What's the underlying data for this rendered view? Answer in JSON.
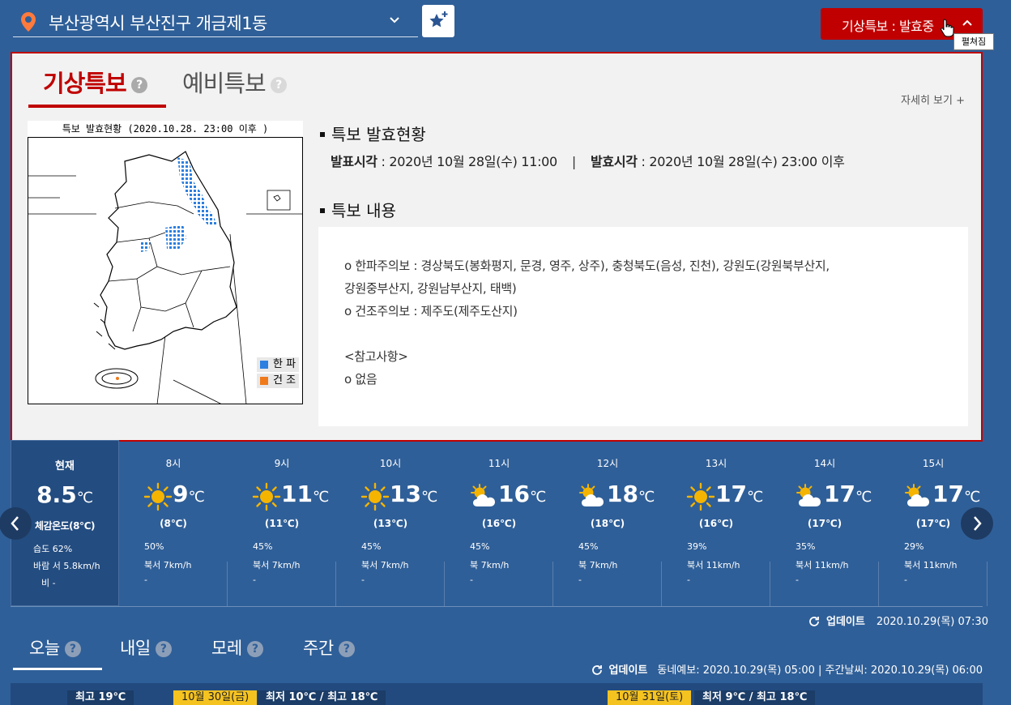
{
  "location": {
    "name": "부산광역시 부산진구 개금제1동"
  },
  "alert_button": {
    "label": "기상특보 : 발효중",
    "tooltip": "펼쳐짐"
  },
  "panel": {
    "tabs": [
      {
        "label": "기상특보",
        "help": "?"
      },
      {
        "label": "예비특보",
        "help": "?"
      }
    ],
    "more_link": "자세히 보기 +",
    "map": {
      "title": "특보 발효현황 (2020.10.28. 23:00 이후 )",
      "legend": [
        {
          "label": "한 파",
          "color": "#2b7fe0"
        },
        {
          "label": "건 조",
          "color": "#f07a1a"
        }
      ]
    },
    "status": {
      "heading": "특보 발효현황",
      "announce_label": "발표시각",
      "announce_value": " : 2020년 10월 28일(수) 11:00",
      "separator": "|",
      "effective_label": "발효시각",
      "effective_value": " : 2020년 10월 28일(수) 23:00 이후"
    },
    "content": {
      "heading": "특보 내용",
      "lines": [
        "o 한파주의보 : 경상북도(봉화평지, 문경, 영주, 상주), 충청북도(음성, 진천), 강원도(강원북부산지,",
        "강원중부산지, 강원남부산지, 태백)",
        "o 건조주의보 : 제주도(제주도산지)",
        "",
        "<참고사항>",
        "o 없음"
      ]
    }
  },
  "current": {
    "label": "현재",
    "temp": "8.5",
    "unit": "℃",
    "feels": "체감온도(8℃)",
    "humidity": "습도 62%",
    "wind": "바람 서 5.8km/h",
    "rain": "비 -"
  },
  "hourly": [
    {
      "hour": "8시",
      "icon": "sun-icon",
      "temp": "9",
      "feels": "(8℃)",
      "humidity": "50%",
      "wind": "북서 7km/h",
      "rain": "-"
    },
    {
      "hour": "9시",
      "icon": "sun-icon",
      "temp": "11",
      "feels": "(11℃)",
      "humidity": "45%",
      "wind": "북서 7km/h",
      "rain": "-"
    },
    {
      "hour": "10시",
      "icon": "sun-icon",
      "temp": "13",
      "feels": "(13℃)",
      "humidity": "45%",
      "wind": "북서 7km/h",
      "rain": "-"
    },
    {
      "hour": "11시",
      "icon": "partly-cloudy-icon",
      "temp": "16",
      "feels": "(16℃)",
      "humidity": "45%",
      "wind": "북 7km/h",
      "rain": "-"
    },
    {
      "hour": "12시",
      "icon": "partly-cloudy-icon",
      "temp": "18",
      "feels": "(18℃)",
      "humidity": "45%",
      "wind": "북 7km/h",
      "rain": "-"
    },
    {
      "hour": "13시",
      "icon": "sun-icon",
      "temp": "17",
      "feels": "(16℃)",
      "humidity": "39%",
      "wind": "북서 11km/h",
      "rain": "-"
    },
    {
      "hour": "14시",
      "icon": "partly-cloudy-icon",
      "temp": "17",
      "feels": "(17℃)",
      "humidity": "35%",
      "wind": "북서 11km/h",
      "rain": "-"
    },
    {
      "hour": "15시",
      "icon": "partly-cloudy-icon",
      "temp": "17",
      "feels": "(17℃)",
      "humidity": "29%",
      "wind": "북서 11km/h",
      "rain": "-"
    }
  ],
  "hourly_unit": "℃",
  "update1": {
    "label": "업데이트",
    "time": "2020.10.29(목) 07:30"
  },
  "day_tabs": [
    {
      "label": "오늘",
      "help": "?"
    },
    {
      "label": "내일",
      "help": "?"
    },
    {
      "label": "모레",
      "help": "?"
    },
    {
      "label": "주간",
      "help": "?"
    }
  ],
  "update2": {
    "label": "업데이트",
    "detail": "동네예보: 2020.10.29(목) 05:00 | 주간날씨: 2020.10.29(목) 06:00"
  },
  "daily_strip": {
    "today_max": "최고 19℃",
    "day1_date": "10월 30일(금)",
    "day1_range": "최저 10℃ / 최고 18℃",
    "day2_date": "10월 31일(토)",
    "day2_range": "최저 9℃ / 최고 18℃"
  },
  "colors": {
    "background": "#2f5f98",
    "alert_red": "#c00000",
    "highlight": "#f5c320"
  }
}
